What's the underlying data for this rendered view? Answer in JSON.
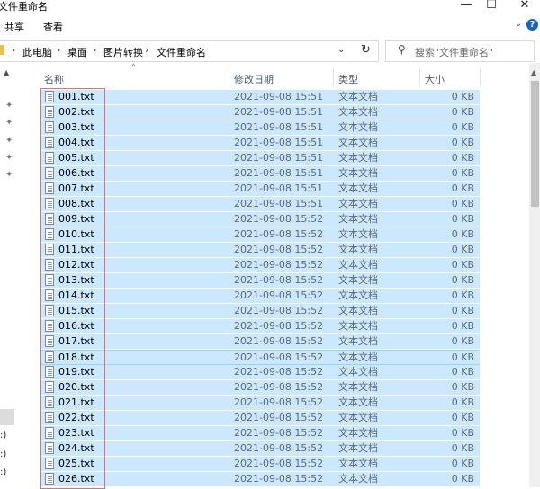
{
  "window": {
    "title": "文件重命名",
    "minimize_glyph": "—",
    "maximize_glyph": "☐",
    "close_glyph": "✕"
  },
  "ribbon": {
    "tabs": [
      "共享",
      "查看"
    ],
    "collapse_glyph": "⌄",
    "help_glyph": "?"
  },
  "address": {
    "breadcrumb": [
      "此电脑",
      "桌面",
      "图片转换",
      "文件重命名"
    ],
    "separator": "›",
    "dropdown_glyph": "⌄",
    "refresh_glyph": "↻",
    "search_icon": "⚲",
    "search_placeholder": "搜索\"文件重命名\""
  },
  "nav": {
    "pin_glyph": "✦",
    "scroll_up_glyph": "▲",
    "drive_labels": [
      ":)",
      ":)",
      ":)"
    ]
  },
  "columns": {
    "name": "名称",
    "date": "修改日期",
    "type": "类型",
    "size": "大小",
    "sort_glyph": "⌃"
  },
  "files": [
    {
      "name": "001.txt",
      "date": "2021-09-08 15:51",
      "type": "文本文档",
      "size": "0 KB"
    },
    {
      "name": "002.txt",
      "date": "2021-09-08 15:51",
      "type": "文本文档",
      "size": "0 KB"
    },
    {
      "name": "003.txt",
      "date": "2021-09-08 15:51",
      "type": "文本文档",
      "size": "0 KB"
    },
    {
      "name": "004.txt",
      "date": "2021-09-08 15:51",
      "type": "文本文档",
      "size": "0 KB"
    },
    {
      "name": "005.txt",
      "date": "2021-09-08 15:51",
      "type": "文本文档",
      "size": "0 KB"
    },
    {
      "name": "006.txt",
      "date": "2021-09-08 15:51",
      "type": "文本文档",
      "size": "0 KB"
    },
    {
      "name": "007.txt",
      "date": "2021-09-08 15:51",
      "type": "文本文档",
      "size": "0 KB"
    },
    {
      "name": "008.txt",
      "date": "2021-09-08 15:51",
      "type": "文本文档",
      "size": "0 KB"
    },
    {
      "name": "009.txt",
      "date": "2021-09-08 15:52",
      "type": "文本文档",
      "size": "0 KB"
    },
    {
      "name": "010.txt",
      "date": "2021-09-08 15:52",
      "type": "文本文档",
      "size": "0 KB"
    },
    {
      "name": "011.txt",
      "date": "2021-09-08 15:52",
      "type": "文本文档",
      "size": "0 KB"
    },
    {
      "name": "012.txt",
      "date": "2021-09-08 15:52",
      "type": "文本文档",
      "size": "0 KB"
    },
    {
      "name": "013.txt",
      "date": "2021-09-08 15:52",
      "type": "文本文档",
      "size": "0 KB"
    },
    {
      "name": "014.txt",
      "date": "2021-09-08 15:52",
      "type": "文本文档",
      "size": "0 KB"
    },
    {
      "name": "015.txt",
      "date": "2021-09-08 15:52",
      "type": "文本文档",
      "size": "0 KB"
    },
    {
      "name": "016.txt",
      "date": "2021-09-08 15:52",
      "type": "文本文档",
      "size": "0 KB"
    },
    {
      "name": "017.txt",
      "date": "2021-09-08 15:52",
      "type": "文本文档",
      "size": "0 KB"
    },
    {
      "name": "018.txt",
      "date": "2021-09-08 15:52",
      "type": "文本文档",
      "size": "0 KB"
    },
    {
      "name": "019.txt",
      "date": "2021-09-08 15:52",
      "type": "文本文档",
      "size": "0 KB"
    },
    {
      "name": "020.txt",
      "date": "2021-09-08 15:52",
      "type": "文本文档",
      "size": "0 KB"
    },
    {
      "name": "021.txt",
      "date": "2021-09-08 15:52",
      "type": "文本文档",
      "size": "0 KB"
    },
    {
      "name": "022.txt",
      "date": "2021-09-08 15:52",
      "type": "文本文档",
      "size": "0 KB"
    },
    {
      "name": "023.txt",
      "date": "2021-09-08 15:52",
      "type": "文本文档",
      "size": "0 KB"
    },
    {
      "name": "024.txt",
      "date": "2021-09-08 15:52",
      "type": "文本文档",
      "size": "0 KB"
    },
    {
      "name": "025.txt",
      "date": "2021-09-08 15:52",
      "type": "文本文档",
      "size": "0 KB"
    },
    {
      "name": "026.txt",
      "date": "2021-09-08 15:52",
      "type": "文本文档",
      "size": "0 KB"
    }
  ],
  "focused_file": "018.txt",
  "colors": {
    "selection": "#cce8ff",
    "focus_border": "#99d1ff",
    "outline": "#e07070",
    "accent": "#1565c0"
  }
}
